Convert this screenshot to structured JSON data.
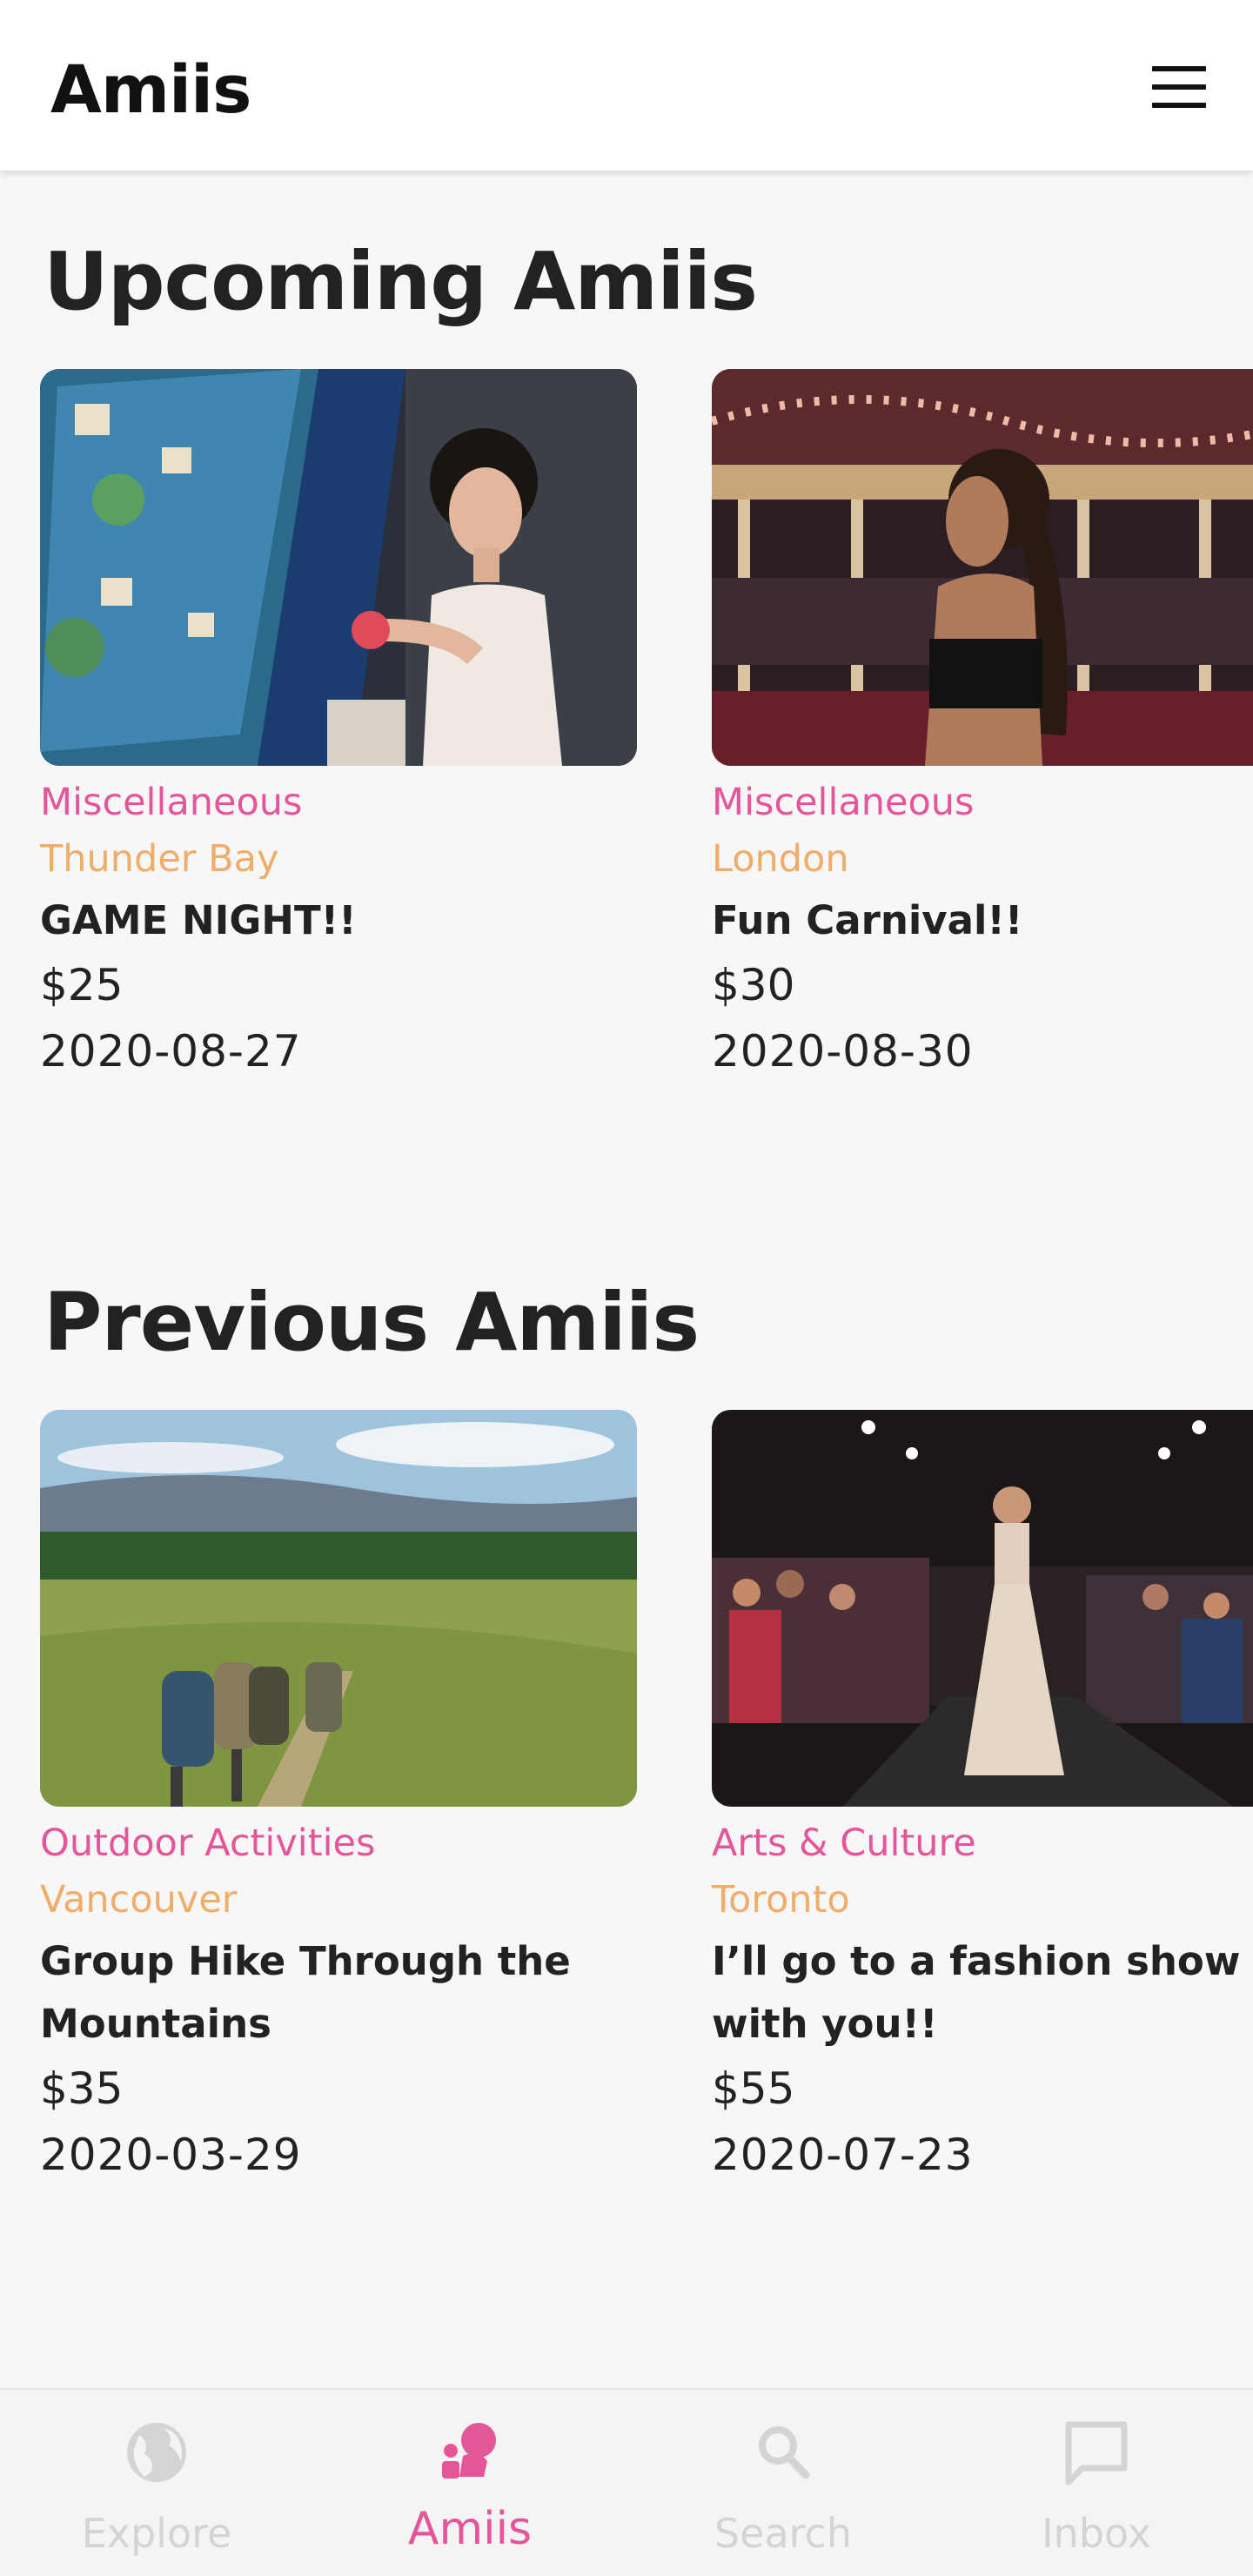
{
  "header": {
    "app_title": "Amiis",
    "menu_icon": "hamburger-menu-icon"
  },
  "upcoming": {
    "title": "Upcoming Amiis",
    "cards": [
      {
        "category": "Miscellaneous",
        "city": "Thunder Bay",
        "title": "GAME NIGHT!!",
        "price": "$25",
        "date": "2020-08-27",
        "image": "woman-at-arcade-machine-photo"
      },
      {
        "category": "Miscellaneous",
        "city": "London",
        "title": "Fun Carnival!!",
        "price": "$30",
        "date": "2020-08-30",
        "image": "woman-at-carousel-photo"
      }
    ]
  },
  "previous": {
    "title": "Previous Amiis",
    "cards": [
      {
        "category": "Outdoor Activities",
        "city": "Vancouver",
        "title": "Group Hike Through the Mountains",
        "price": "$35",
        "date": "2020-03-29",
        "image": "hikers-in-meadow-photo"
      },
      {
        "category": "Arts & Culture",
        "city": "Toronto",
        "title": "I’ll go to a fashion show with you!!",
        "price": "$55",
        "date": "2020-07-23",
        "image": "runway-fashion-show-photo"
      }
    ]
  },
  "bottom_nav": {
    "items": [
      {
        "label": "Explore",
        "icon": "globe-icon",
        "active": false
      },
      {
        "label": "Amiis",
        "icon": "people-icon",
        "active": true
      },
      {
        "label": "Search",
        "icon": "search-icon",
        "active": false
      },
      {
        "label": "Inbox",
        "icon": "chat-icon",
        "active": false
      }
    ]
  },
  "colors": {
    "category": "#e5559a",
    "city": "#f0ad6a",
    "active_nav": "#e5559a",
    "inactive_nav": "#d4d4d6",
    "page_background": "#f7f7f8"
  }
}
